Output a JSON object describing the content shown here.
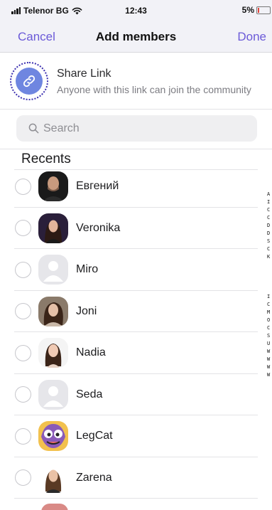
{
  "status_bar": {
    "carrier": "Telenor BG",
    "time": "12:43",
    "battery": "5%",
    "battery_level": 0.05
  },
  "nav": {
    "cancel_label": "Cancel",
    "title": "Add members",
    "done_label": "Done"
  },
  "share_link": {
    "title": "Share Link",
    "subtitle": "Anyone with this link can join the community"
  },
  "search": {
    "placeholder": "Search"
  },
  "section": {
    "title": "Recents"
  },
  "contacts": [
    {
      "name": "Евгений",
      "avatar": "photo"
    },
    {
      "name": "Veronika",
      "avatar": "photo"
    },
    {
      "name": "Miro",
      "avatar": "default"
    },
    {
      "name": "Joni",
      "avatar": "photo"
    },
    {
      "name": "Nadia",
      "avatar": "photo"
    },
    {
      "name": "Seda",
      "avatar": "default"
    },
    {
      "name": "LegCat",
      "avatar": "cartoon"
    },
    {
      "name": "Zarena",
      "avatar": "photo"
    }
  ],
  "side_text": {
    "upper": "AICCDDSCK",
    "lower": "ICMOCSUWWWW"
  },
  "colors": {
    "accent": "#6b5ad8",
    "share_icon_bg": "#6f86e0",
    "divider": "#e3e3e6"
  }
}
